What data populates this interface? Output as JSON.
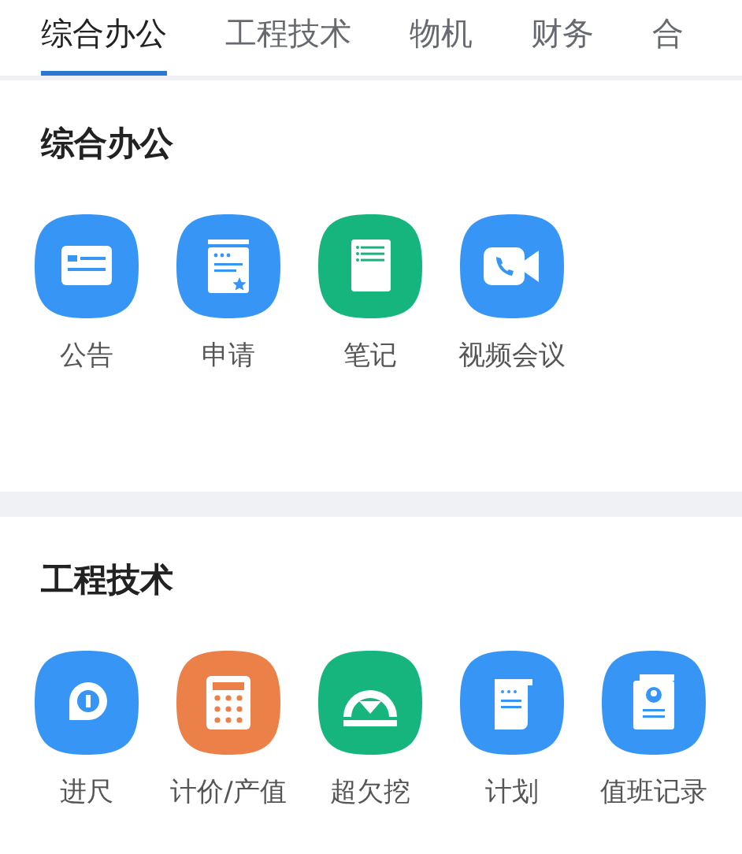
{
  "tabs": [
    {
      "label": "综合办公",
      "selected": true
    },
    {
      "label": "工程技术",
      "selected": false
    },
    {
      "label": "物机",
      "selected": false
    },
    {
      "label": "财务",
      "selected": false
    },
    {
      "label": "合",
      "selected": false
    }
  ],
  "sections": [
    {
      "title": "综合办公",
      "items": [
        {
          "label": "公告",
          "kind": "card",
          "color": "#3796f5"
        },
        {
          "label": "申请",
          "kind": "form",
          "color": "#3796f5"
        },
        {
          "label": "笔记",
          "kind": "note",
          "color": "#17b57e"
        },
        {
          "label": "视频会议",
          "kind": "video",
          "color": "#3796f5"
        }
      ]
    },
    {
      "title": "工程技术",
      "items": [
        {
          "label": "进尺",
          "kind": "tape",
          "color": "#3796f5"
        },
        {
          "label": "计价/产值",
          "kind": "calculator",
          "color": "#ec8049"
        },
        {
          "label": "超欠挖",
          "kind": "gauge",
          "color": "#17b57e"
        },
        {
          "label": "计划",
          "kind": "scroll",
          "color": "#3796f5"
        },
        {
          "label": "值班记录",
          "kind": "book",
          "color": "#3796f5"
        }
      ]
    }
  ]
}
